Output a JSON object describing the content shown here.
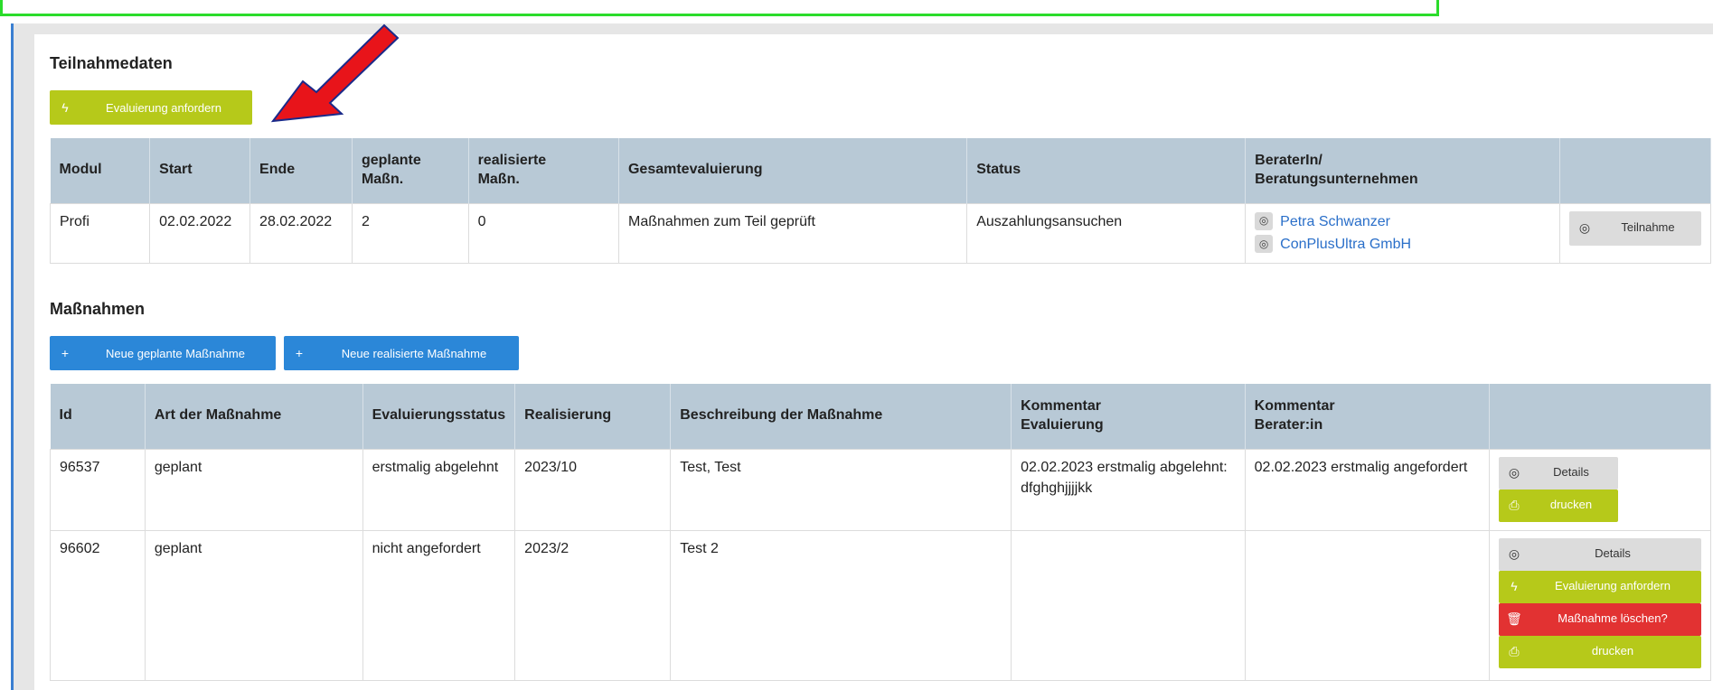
{
  "participation": {
    "title": "Teilnahmedaten",
    "request_eval_label": "Evaluierung anfordern",
    "headers": [
      "Modul",
      "Start",
      "Ende",
      "geplante Maßn.",
      "realisierte Maßn.",
      "Gesamtevaluierung",
      "Status",
      "BeraterIn/ Beratungsunternehmen",
      ""
    ],
    "row": {
      "modul": "Profi",
      "start": "02.02.2022",
      "ende": "28.02.2022",
      "geplant": "2",
      "realisiert": "0",
      "gesamt": "Maßnahmen zum Teil geprüft",
      "status": "Auszahlungsansuchen",
      "berater": "Petra Schwanzer",
      "unternehmen": "ConPlusUltra GmbH",
      "teilnahme_label": "Teilnahme"
    }
  },
  "measures": {
    "title": "Maßnahmen",
    "new_planned_label": "Neue geplante Maßnahme",
    "new_realized_label": "Neue realisierte Maßnahme",
    "headers": [
      "Id",
      "Art der Maßnahme",
      "Evaluierungsstatus",
      "Realisierung",
      "Beschreibung der Maßnahme",
      "Kommentar Evaluierung",
      "Kommentar Berater:in",
      ""
    ],
    "rows": [
      {
        "id": "96537",
        "art": "geplant",
        "status": "erstmalig abgelehnt",
        "realisierung": "2023/10",
        "beschreibung": "Test, Test",
        "kommentar_eval": "02.02.2023 erstmalig abgelehnt: dfghghjjjjkk",
        "kommentar_berater": "02.02.2023 erstmalig angefordert",
        "details_label": "Details",
        "print_label": "drucken"
      },
      {
        "id": "96602",
        "art": "geplant",
        "status": "nicht angefordert",
        "realisierung": "2023/2",
        "beschreibung": "Test 2",
        "kommentar_eval": "",
        "kommentar_berater": "",
        "details_label": "Details",
        "request_eval_label": "Evaluierung anfordern",
        "delete_label": "Maßnahme löschen?",
        "print_label": "drucken"
      }
    ]
  },
  "colors": {
    "green": "#b6c91a",
    "blue": "#2b87d8",
    "red": "#e23232",
    "header_bg": "#b8c9d6",
    "arrow": "#e8141a"
  }
}
